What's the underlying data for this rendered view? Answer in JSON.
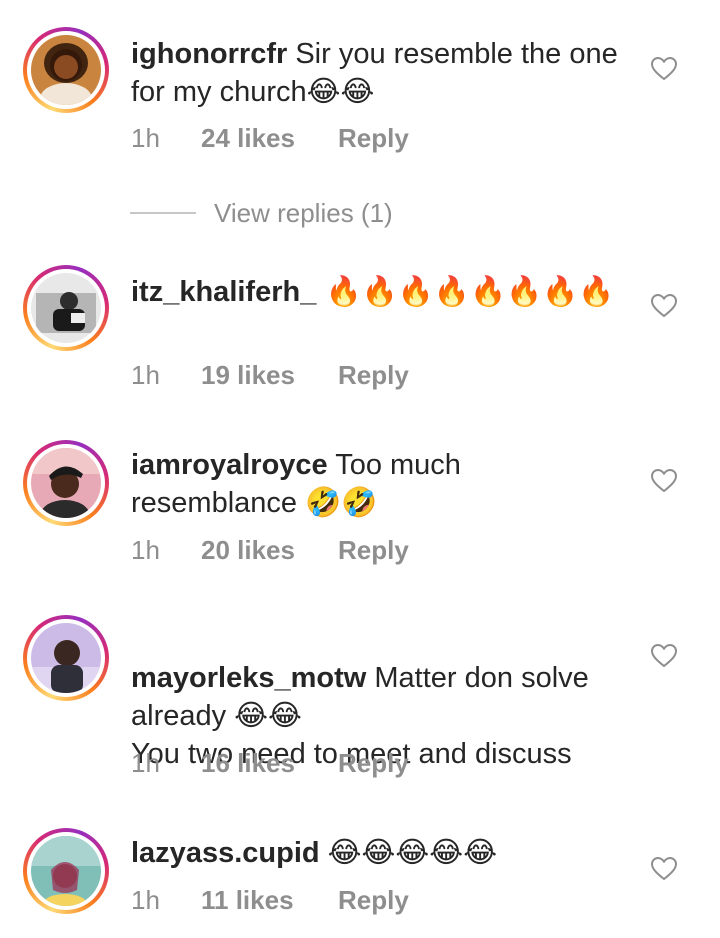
{
  "comments": [
    {
      "username": "ighonorrcfr",
      "text": " Sir you resemble the one for my church😂😂",
      "time": "1h",
      "likes": "24 likes",
      "reply_label": "Reply",
      "avatar_colors": [
        "#7a3b1e",
        "#e9a24a"
      ]
    },
    {
      "username": "itz_khaliferh_",
      "text": " 🔥🔥🔥🔥🔥🔥🔥🔥",
      "time": "1h",
      "likes": "19 likes",
      "reply_label": "Reply",
      "avatar_colors": [
        "#d9d9d9",
        "#444444"
      ]
    },
    {
      "username": "iamroyalroyce",
      "text": " Too much resemblance 🤣🤣",
      "time": "1h",
      "likes": "20 likes",
      "reply_label": "Reply",
      "avatar_colors": [
        "#e9a7b5",
        "#2b2b2b"
      ]
    },
    {
      "username": "mayorleks_motw",
      "text": " Matter don solve already 😂😂\nYou two need to meet and discuss",
      "time": "1h",
      "likes": "16 likes",
      "reply_label": "Reply",
      "avatar_colors": [
        "#c9b7e3",
        "#3a2c2a"
      ]
    },
    {
      "username": "lazyass.cupid",
      "text": " 😂😂😂😂😂",
      "time": "1h",
      "likes": "11 likes",
      "reply_label": "Reply",
      "avatar_colors": [
        "#6fb6b0",
        "#8a4a3c"
      ]
    }
  ],
  "view_replies": "View replies (1)",
  "icons": {
    "like": "heart-outline-icon"
  },
  "colors": {
    "text": "#262626",
    "muted": "#8e8e8e"
  }
}
